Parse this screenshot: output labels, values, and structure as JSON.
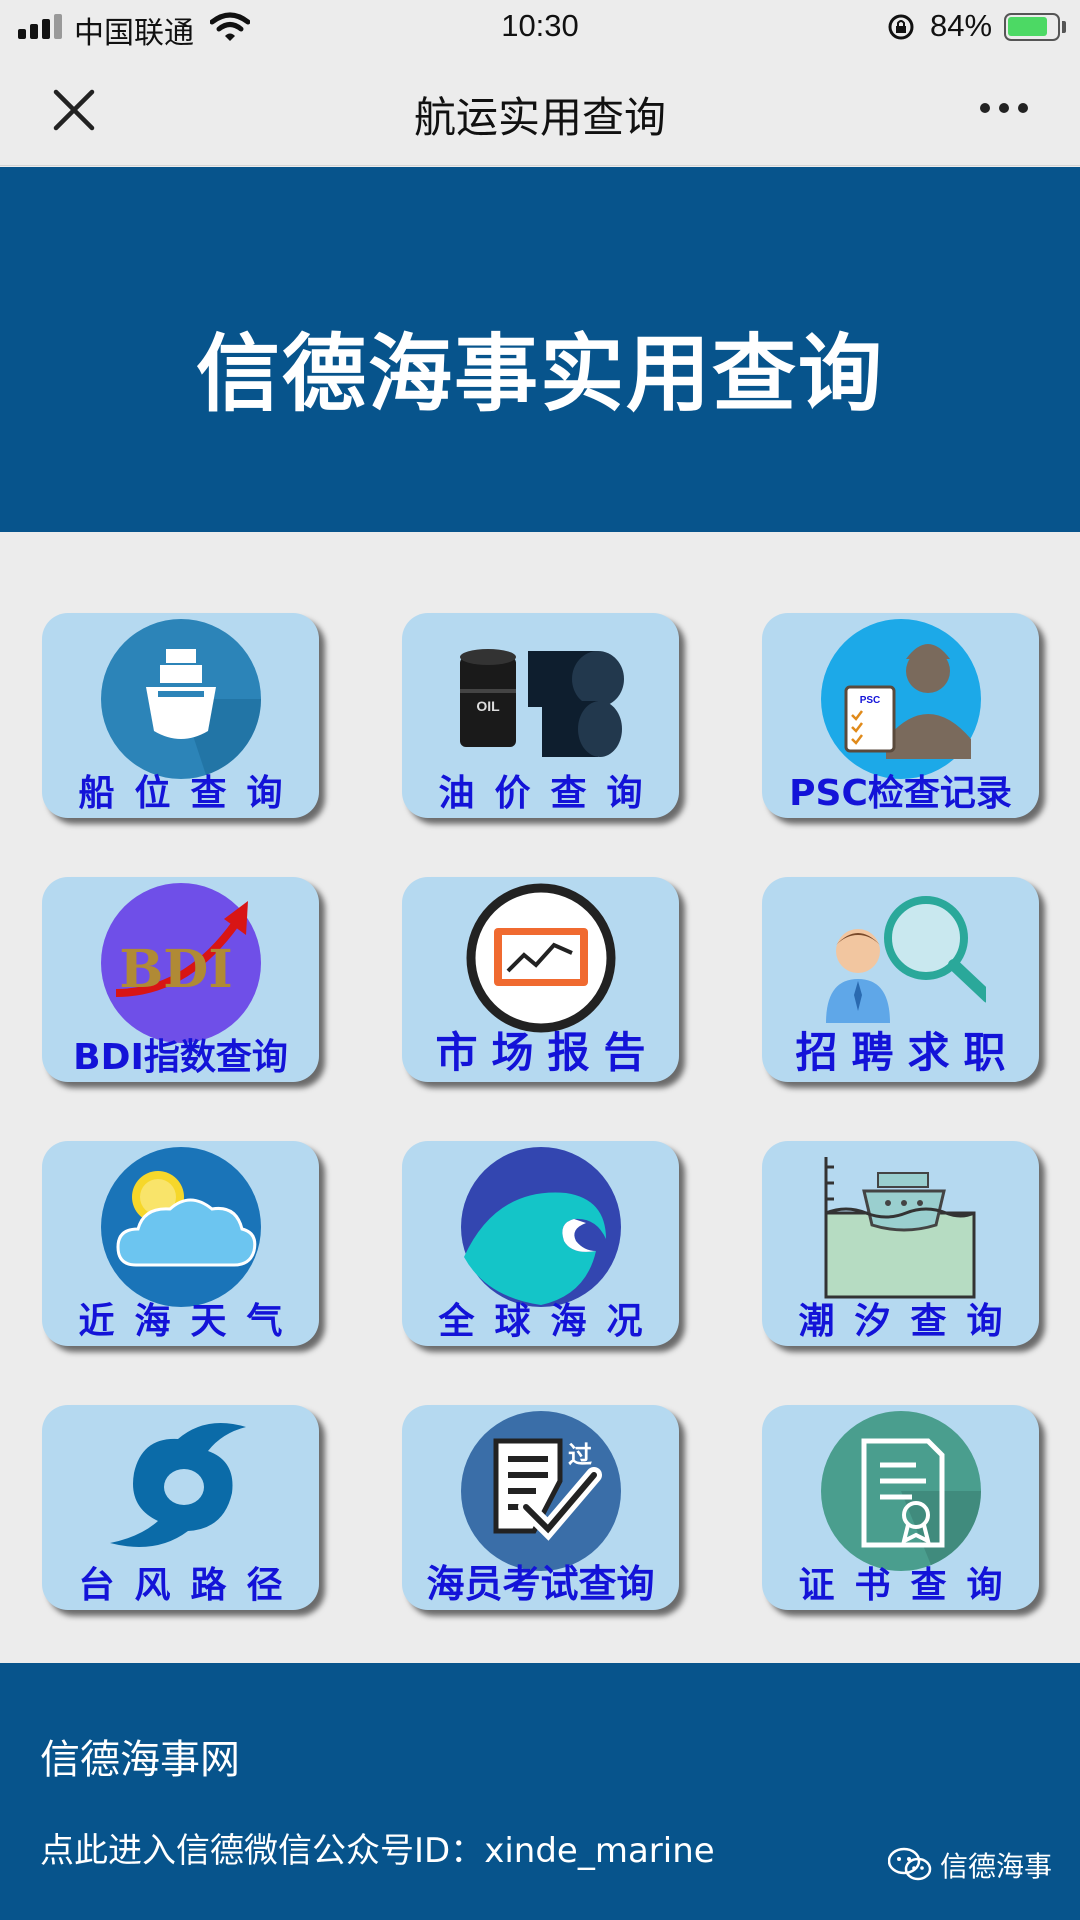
{
  "status": {
    "carrier": "中国联通",
    "time": "10:30",
    "battery": "84%",
    "battery_level": 0.84
  },
  "nav": {
    "title": "航运实用查询"
  },
  "banner": {
    "title": "信德海事实用查询"
  },
  "tiles": [
    {
      "label": "船位查询",
      "icon": "ship-icon"
    },
    {
      "label": "油价查询",
      "icon": "oil-barrel-icon"
    },
    {
      "label": "PSC检查记录",
      "icon": "psc-inspector-icon"
    },
    {
      "label": "BDI指数查询",
      "icon": "bdi-icon"
    },
    {
      "label": "市场报告",
      "icon": "chart-monitor-icon"
    },
    {
      "label": "招聘求职",
      "icon": "recruit-search-icon"
    },
    {
      "label": "近海天气",
      "icon": "weather-icon"
    },
    {
      "label": "全球海况",
      "icon": "wave-icon"
    },
    {
      "label": "潮汐查询",
      "icon": "tide-icon"
    },
    {
      "label": "台风路径",
      "icon": "typhoon-icon"
    },
    {
      "label": "海员考试查询",
      "icon": "exam-icon"
    },
    {
      "label": "证书查询",
      "icon": "certificate-icon"
    }
  ],
  "footer": {
    "title": "信德海事网",
    "link": "点此进入信德微信公众号ID：xinde_marine",
    "brand": "信德海事"
  },
  "colors": {
    "banner": "#07548c",
    "tile": "#b5d9f0",
    "label": "#1313d8",
    "background": "#ececec"
  }
}
